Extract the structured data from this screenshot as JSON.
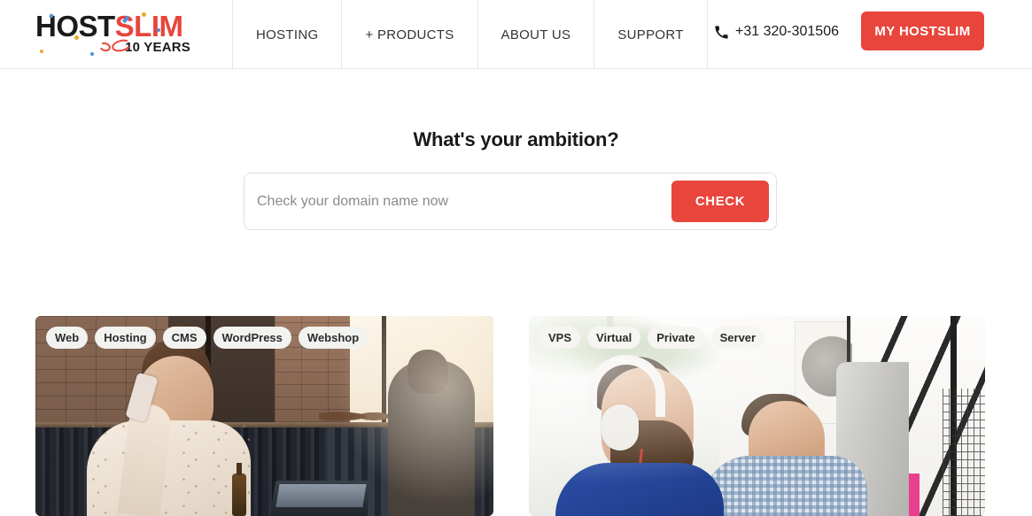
{
  "header": {
    "logo": {
      "part1": "HOST",
      "part2": "SLIM",
      "tagline": "10 YEARS"
    },
    "nav": [
      {
        "label": "HOSTING"
      },
      {
        "label": "+ PRODUCTS"
      },
      {
        "label": "ABOUT US"
      },
      {
        "label": "SUPPORT"
      }
    ],
    "phone": {
      "icon": "phone-icon",
      "number": "+31 320-301506"
    },
    "account_button": "MY HOSTSLIM"
  },
  "hero": {
    "title": "What's your ambition?",
    "search": {
      "placeholder": "Check your domain name now",
      "value": "",
      "button": "CHECK"
    }
  },
  "cards": [
    {
      "name": "web-hosting-card",
      "tags": [
        "Web",
        "Hosting",
        "CMS",
        "WordPress",
        "Webshop"
      ],
      "image_alt": "Woman on phone in a clothing store with man browsing racks"
    },
    {
      "name": "vps-card",
      "tags": [
        "VPS",
        "Virtual",
        "Private",
        "Server"
      ],
      "image_alt": "Two men working at computers in a bright office"
    }
  ],
  "colors": {
    "accent": "#e8453c",
    "text": "#1a1a1a",
    "border": "#e6e6e6",
    "placeholder": "#8a8a8a"
  }
}
